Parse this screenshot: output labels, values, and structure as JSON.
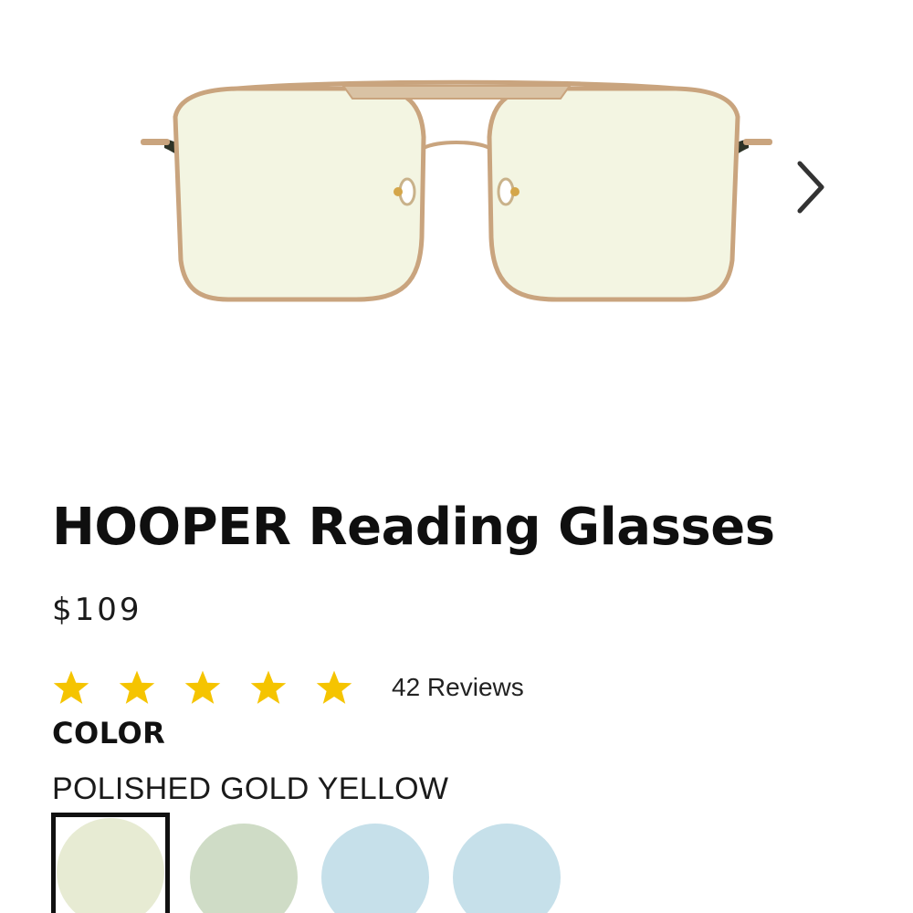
{
  "product": {
    "title": "HOOPER Reading Glasses",
    "price": "$109",
    "rating_value": 5,
    "rating_max": 5,
    "reviews_label": "42 Reviews"
  },
  "color_section": {
    "heading": "COLOR",
    "selected_name": "POLISHED GOLD YELLOW",
    "swatches": [
      {
        "color": "#e7ebd3",
        "selected": true
      },
      {
        "color": "#cfdcc6",
        "selected": false
      },
      {
        "color": "#c6e0ea",
        "selected": false
      },
      {
        "color": "#c6e0ea",
        "selected": false
      }
    ]
  },
  "gallery": {
    "next_icon": "chevron-right-icon"
  },
  "colors": {
    "star": "#f5c400",
    "frame_gold": "#c9a47e",
    "lens_tint": "#f3f5e2",
    "temple_dark": "#2d3327"
  }
}
